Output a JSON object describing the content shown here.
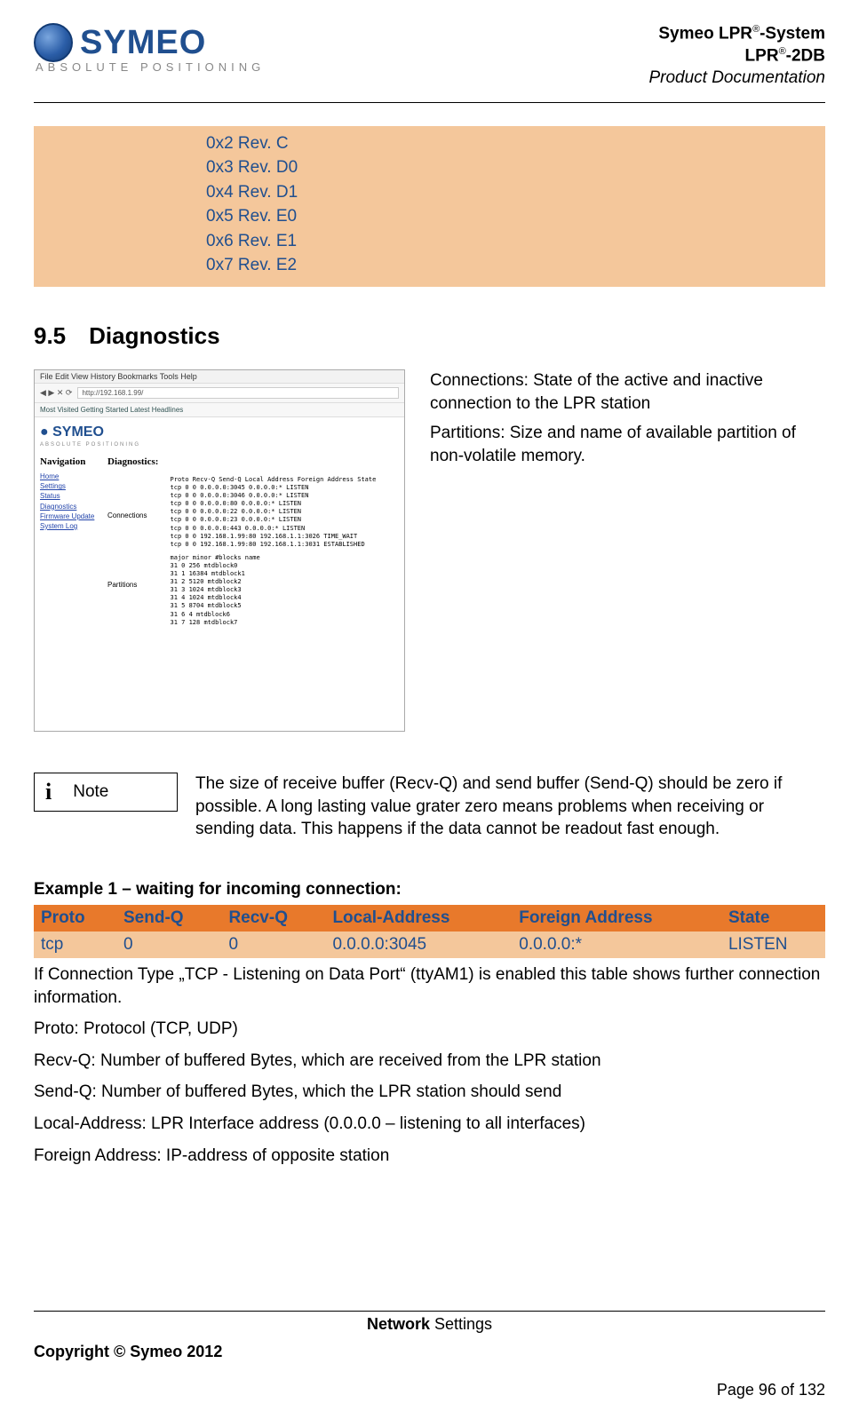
{
  "header": {
    "logo_text": "SYMEO",
    "logo_tag": "ABSOLUTE POSITIONING",
    "line1a": "Symeo LPR",
    "line1b": "-System",
    "line2a": "LPR",
    "line2b": "-2DB",
    "line3": "Product Documentation",
    "sup": "®"
  },
  "rev_list": [
    "0x2 Rev. C",
    "0x3 Rev. D0",
    "0x4 Rev. D1",
    "0x5 Rev. E0",
    "0x6 Rev. E1",
    "0x7 Rev. E2"
  ],
  "section": {
    "num": "9.5",
    "title": "Diagnostics"
  },
  "diag": {
    "p1": "Connections: State of the active and inactive connection to the LPR station",
    "p2": "Partitions: Size and name of available partition of non-volatile memory."
  },
  "screenshot": {
    "menu": "File  Edit  View  History  Bookmarks  Tools  Help",
    "url": "http://192.168.1.99/",
    "bookmarks": "Most Visited  Getting Started  Latest Headlines",
    "logo": "SYMEO",
    "tag": "ABSOLUTE POSITIONING",
    "nav_head": "Navigation",
    "nav_items": [
      "Home",
      "Settings",
      "Status",
      "Diagnostics",
      "Firmware Update",
      "System Log"
    ],
    "diag_head": "Diagnostics:",
    "conn_label": "Connections",
    "conn_header": "Proto Recv-Q Send-Q Local Address    Foreign Address  State",
    "conn_rows": [
      "tcp   0      0      0.0.0.0:3045     0.0.0.0:*        LISTEN",
      "tcp   0      0      0.0.0.0:3046     0.0.0.0:*        LISTEN",
      "tcp   0      0      0.0.0.0:80       0.0.0.0:*        LISTEN",
      "tcp   0      0      0.0.0.0:22       0.0.0.0:*        LISTEN",
      "tcp   0      0      0.0.0.0:23       0.0.0.0:*        LISTEN",
      "tcp   0      0      0.0.0.0:443      0.0.0.0:*        LISTEN",
      "tcp   0      0      192.168.1.99:80  192.168.1.1:3026 TIME_WAIT",
      "tcp   0      0      192.168.1.99:80  192.168.1.1:3031 ESTABLISHED"
    ],
    "part_label": "Partitions",
    "part_header": "major minor #blocks name",
    "part_rows": [
      "31    0     256     mtdblock0",
      "31    1     16384   mtdblock1",
      "31    2     5120    mtdblock2",
      "31    3     1024    mtdblock3",
      "31    4     1024    mtdblock4",
      "31    5     8704    mtdblock5",
      "31    6     4       mtdblock6",
      "31    7     128     mtdblock7"
    ]
  },
  "note": {
    "label": "Note",
    "text": "The size of receive buffer (Recv-Q) and send buffer (Send-Q) should be zero if possible. A long lasting value grater zero means problems when receiving or sending data. This happens if the data cannot be readout fast enough."
  },
  "example": {
    "title": "Example 1 – waiting for incoming connection:",
    "headers": [
      "Proto",
      "Send-Q",
      "Recv-Q",
      "Local-Address",
      "Foreign Address",
      "State"
    ],
    "row": [
      "tcp",
      "0",
      "0",
      "0.0.0.0:3045",
      "0.0.0.0:*",
      "LISTEN"
    ]
  },
  "paras": {
    "p1": "If Connection Type „TCP - Listening on Data Port“ (ttyAM1) is enabled this table shows further connection information.",
    "p2": "Proto: Protocol (TCP, UDP)",
    "p3": "Recv-Q: Number of buffered Bytes, which are received from the LPR station",
    "p4": "Send-Q: Number of buffered Bytes, which the LPR station should send",
    "p5": "Local-Address: LPR Interface address (0.0.0.0 – listening to all interfaces)",
    "p6": "Foreign Address: IP-address of opposite station"
  },
  "footer": {
    "center_b": "Network",
    "center_r": " Settings",
    "copyright": "Copyright © Symeo 2012",
    "page": "Page 96 of 132"
  }
}
